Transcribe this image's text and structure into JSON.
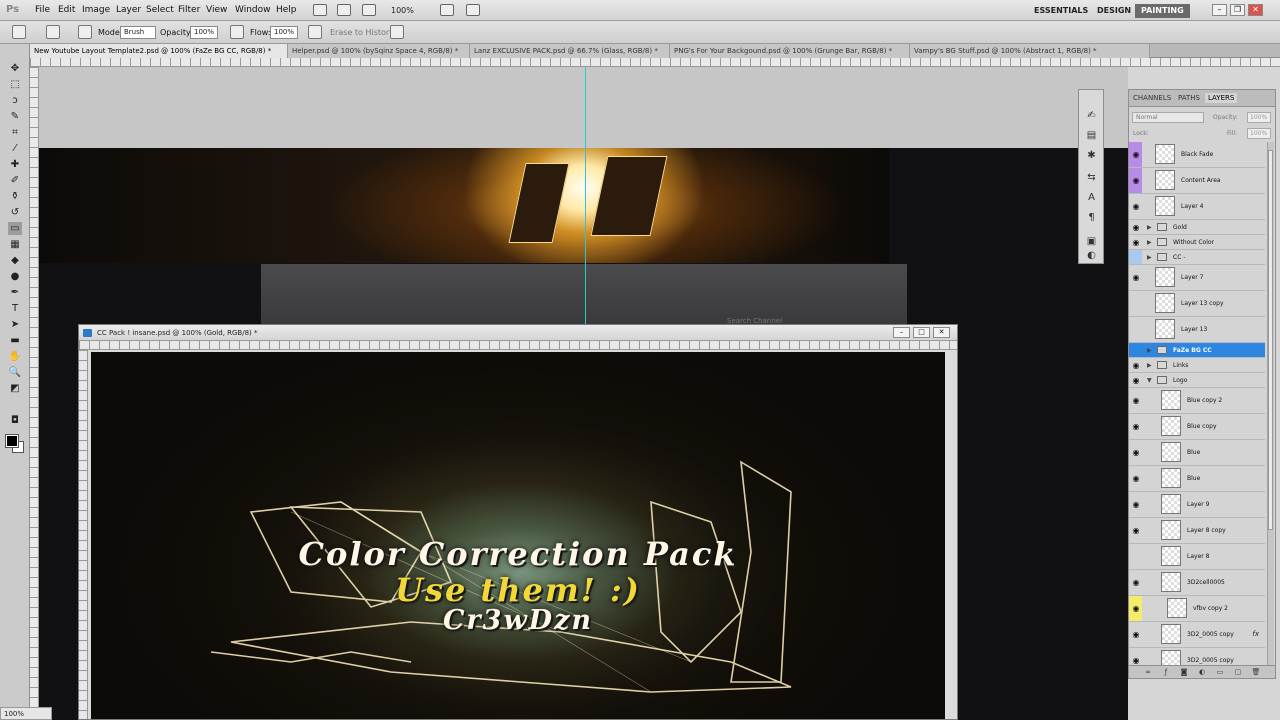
{
  "menubar": {
    "logo": "Ps",
    "items": [
      "File",
      "Edit",
      "Image",
      "Layer",
      "Select",
      "Filter",
      "View",
      "Window",
      "Help"
    ],
    "zoom": "100%",
    "workspaces": [
      "ESSENTIALS",
      "DESIGN",
      "PAINTING"
    ]
  },
  "options": {
    "mode_label": "Mode:",
    "mode_value": "Brush",
    "opacity_label": "Opacity:",
    "opacity_value": "100%",
    "flow_label": "Flow:",
    "flow_value": "100%",
    "history_label": "Erase to History"
  },
  "tabs": [
    "New Youtube Layout Template2.psd @ 100% (FaZe BG CC, RGB/8) *",
    "Helper.psd @ 100% (bySqinz Space 4, RGB/8) *",
    "Lanz EXCLUSIVE PACK.psd @ 66.7% (Glass, RGB/8) *",
    "PNG's For Your Backgound.psd @ 100% (Grunge Bar, RGB/8) *",
    "Vampy's BG Stuff.psd @ 100% (Abstract 1, RGB/8) *"
  ],
  "canvas": {
    "search_text": "Search Channel"
  },
  "docwin": {
    "title": "CC Pack ! insane.psd @ 100% (Gold, RGB/8) *",
    "art_line1": "Color Correction Pack",
    "art_line2": "Use them! :)",
    "art_line3": "Cr3wDzn",
    "zoom": "100%"
  },
  "layers_panel": {
    "tabs": [
      "CHANNELS",
      "PATHS",
      "LAYERS"
    ],
    "blend_mode": "Normal",
    "opacity_label": "Opacity:",
    "opacity_value": "100%",
    "lock_label": "Lock:",
    "fill_label": "Fill:",
    "fill_value": "100%",
    "layers": [
      {
        "name": "Black Fade",
        "type": "layer",
        "visible": true,
        "mark": "#b98be8"
      },
      {
        "name": "Content Area",
        "type": "layer",
        "visible": true,
        "mark": "#b98be8"
      },
      {
        "name": "Layer 4",
        "type": "layer",
        "visible": true,
        "mark": ""
      },
      {
        "name": "Gold",
        "type": "group",
        "visible": true,
        "mark": ""
      },
      {
        "name": "Without Color",
        "type": "group",
        "visible": true,
        "mark": ""
      },
      {
        "name": "CC -",
        "type": "group",
        "visible": false,
        "mark": "#a9c9ef"
      },
      {
        "name": "Layer 7",
        "type": "layer",
        "visible": true,
        "mark": ""
      },
      {
        "name": "Layer 13 copy",
        "type": "layer",
        "visible": false,
        "mark": ""
      },
      {
        "name": "Layer 13",
        "type": "layer",
        "visible": false,
        "mark": ""
      },
      {
        "name": "FaZe BG CC",
        "type": "group",
        "visible": false,
        "mark": "",
        "selected": true
      },
      {
        "name": "Links",
        "type": "group",
        "visible": true,
        "mark": ""
      },
      {
        "name": "Logo",
        "type": "group-open",
        "visible": true,
        "mark": ""
      },
      {
        "name": "Blue copy 2",
        "type": "layer",
        "visible": true,
        "mark": "",
        "indent": true
      },
      {
        "name": "Blue copy",
        "type": "layer",
        "visible": true,
        "mark": "",
        "indent": true
      },
      {
        "name": "Blue",
        "type": "layer",
        "visible": true,
        "mark": "",
        "indent": true
      },
      {
        "name": "Blue",
        "type": "layer",
        "visible": true,
        "mark": "",
        "indent": true
      },
      {
        "name": "Layer 9",
        "type": "layer",
        "visible": true,
        "mark": "",
        "indent": true
      },
      {
        "name": "Layer 8 copy",
        "type": "layer",
        "visible": true,
        "mark": "",
        "indent": true
      },
      {
        "name": "Layer 8",
        "type": "layer",
        "visible": false,
        "mark": "",
        "indent": true
      },
      {
        "name": "3D2cell0005",
        "type": "layer",
        "visible": true,
        "mark": "",
        "indent": true
      },
      {
        "name": "vfbv copy 2",
        "type": "layer",
        "visible": true,
        "mark": "#f4ec6a",
        "indent": true,
        "clip": true
      },
      {
        "name": "3D2_0005 copy",
        "type": "layer",
        "visible": true,
        "mark": "",
        "indent": true,
        "fx": true
      },
      {
        "name": "3D2_0005 copy",
        "type": "layer",
        "visible": true,
        "mark": "",
        "indent": true
      }
    ]
  }
}
